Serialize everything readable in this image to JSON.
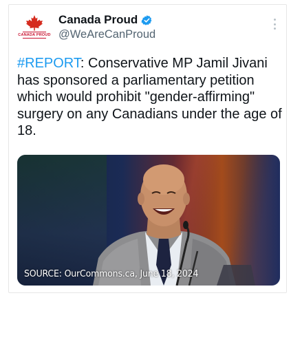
{
  "account": {
    "name": "Canada Proud",
    "handle": "@WeAreCanProud",
    "avatar_text": "CANADA PROUD",
    "verified": true
  },
  "tweet": {
    "hashtag": "#REPORT",
    "body": ": Conservative MP Jamil Jivani has sponsored a parliamentary petition which would prohibit \"gender-affirming\" surgery on any Canadians under the age of 18."
  },
  "media": {
    "caption": "SOURCE: OurCommons.ca, June 18, 2024"
  },
  "icons": [
    "maple-leaf-icon",
    "verified-badge-icon",
    "more-options-icon"
  ],
  "colors": {
    "link": "#1d9bf0",
    "text": "#0f1419",
    "secondary": "#536471",
    "brand_red": "#c8102e"
  }
}
